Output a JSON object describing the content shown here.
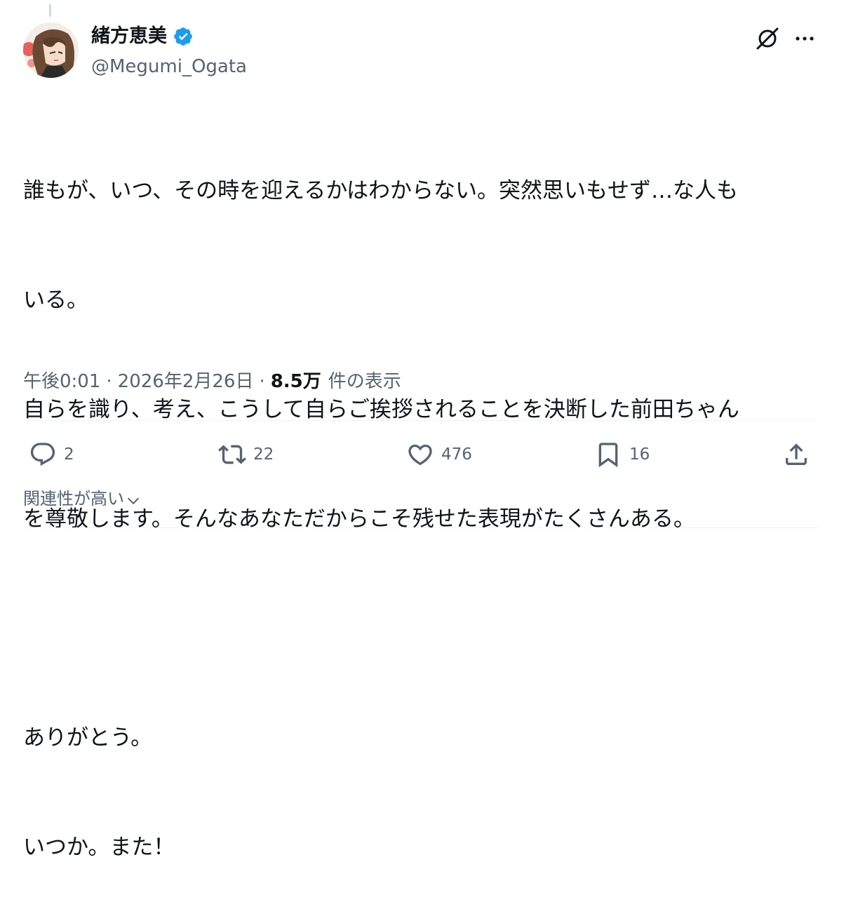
{
  "author": {
    "display_name": "緒方恵美",
    "handle": "@Megumi_Ogata",
    "verified": true,
    "verified_color": "#1d9bf0"
  },
  "header_icons": [
    "grok-icon",
    "more-icon"
  ],
  "tweet": {
    "lines": [
      "誰もが、いつ、その時を迎えるかはわからない。突然思いもせず…な人も",
      "いる。",
      "自らを識り、考え、こうして自らご挨拶されることを決断した前田ちゃん",
      "を尊敬します。そんなあなただからこそ残せた表現がたくさんある。",
      "",
      "ありがとう。",
      "いつか。また！"
    ]
  },
  "meta": {
    "time": "午後0:01",
    "date": "2026年2月26日",
    "views_count": "8.5万",
    "views_label": "件の表示",
    "separator": "·"
  },
  "actions": {
    "replies": "2",
    "retweets": "22",
    "likes": "476",
    "bookmarks": "16"
  },
  "sort": {
    "label": "関連性が高い"
  },
  "colors": {
    "text_primary": "#0f1419",
    "text_secondary": "#536471",
    "divider": "#eff3f4",
    "accent": "#1d9bf0"
  }
}
